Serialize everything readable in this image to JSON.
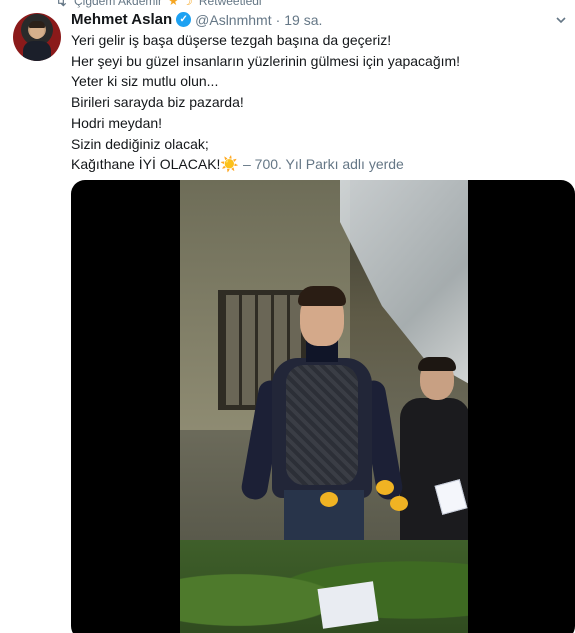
{
  "retweet": {
    "label": "Çiğdem Akdemir",
    "suffix": "Retweetledi"
  },
  "tweet": {
    "author_name": "Mehmet Aslan",
    "handle": "@Aslnmhmt",
    "separator": "·",
    "time": "19 sa.",
    "lines": [
      "Yeri gelir iş başa düşerse tezgah başına da geçeriz!",
      "Her şeyi bu güzel insanların yüzlerinin gülmesi için yapacağım!",
      "Yeter ki siz mutlu olun...",
      "Birileri sarayda biz pazarda!",
      "Hodri meydan!",
      "Sizin dediğiniz olacak;",
      "Kağıthane İYİ OLACAK!"
    ],
    "place": "– 700. Yıl Parkı adlı yerde"
  },
  "icons": {
    "retweet": "retweet-icon",
    "verified": "verified-badge-icon",
    "menu": "chevron-down-icon",
    "emoji": "sun-emoji"
  },
  "colors": {
    "accent": "#1da1f2",
    "secondary_text": "#657786",
    "text": "#14171a"
  }
}
